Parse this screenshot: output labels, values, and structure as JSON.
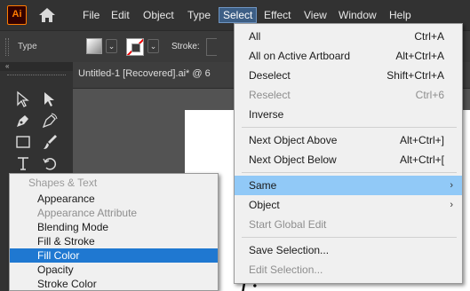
{
  "app": {
    "logo_text": "Ai"
  },
  "menubar": {
    "items": [
      {
        "label": "File"
      },
      {
        "label": "Edit"
      },
      {
        "label": "Object"
      },
      {
        "label": "Type"
      },
      {
        "label": "Select",
        "active": true
      },
      {
        "label": "Effect"
      },
      {
        "label": "View"
      },
      {
        "label": "Window"
      },
      {
        "label": "Help"
      }
    ]
  },
  "control_bar": {
    "type_label": "Type",
    "stroke_label": "Stroke:"
  },
  "toolbar": {
    "collapse_label": "«"
  },
  "document": {
    "tab_title": "Untitled-1 [Recovered].ai* @ 6"
  },
  "select_menu": {
    "items": [
      {
        "label": "All",
        "shortcut": "Ctrl+A"
      },
      {
        "label": "All on Active Artboard",
        "shortcut": "Alt+Ctrl+A"
      },
      {
        "label": "Deselect",
        "shortcut": "Shift+Ctrl+A"
      },
      {
        "label": "Reselect",
        "shortcut": "Ctrl+6",
        "disabled": true
      },
      {
        "label": "Inverse",
        "shortcut": ""
      },
      {
        "label": "Next Object Above",
        "shortcut": "Alt+Ctrl+]"
      },
      {
        "label": "Next Object Below",
        "shortcut": "Alt+Ctrl+["
      },
      {
        "label": "Same",
        "submenu": true,
        "highlighted": true
      },
      {
        "label": "Object",
        "submenu": true
      },
      {
        "label": "Start Global Edit",
        "disabled": true
      },
      {
        "label": "Save Selection...",
        "shortcut": ""
      },
      {
        "label": "Edit Selection...",
        "disabled": true
      }
    ]
  },
  "same_submenu": {
    "items": [
      {
        "label": "Shapes & Text",
        "group": true
      },
      {
        "label": "Appearance"
      },
      {
        "label": "Appearance Attribute",
        "disabled": true
      },
      {
        "label": "Blending Mode"
      },
      {
        "label": "Fill & Stroke"
      },
      {
        "label": "Fill Color",
        "selected": true
      },
      {
        "label": "Opacity"
      },
      {
        "label": "Stroke Color"
      }
    ]
  },
  "colors": {
    "menubar_bg": "#323232",
    "menu_bg": "#f0f0f0",
    "menu_highlight": "#91c9f7",
    "submenu_selected": "#1f78d1",
    "brand_orange": "#ff7c00"
  }
}
